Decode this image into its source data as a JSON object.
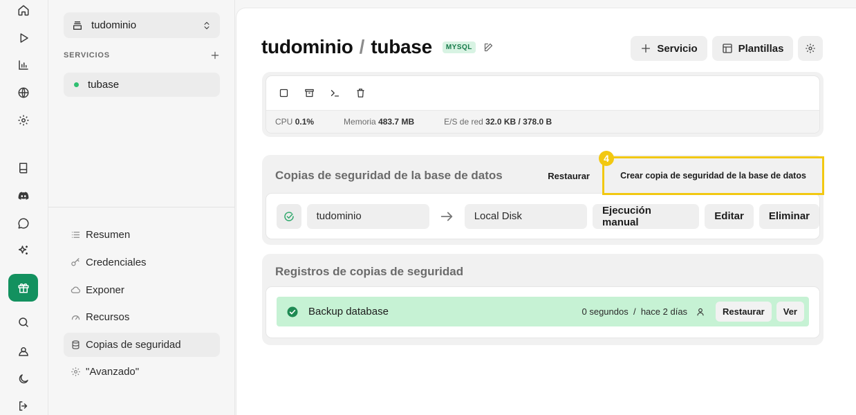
{
  "rail": {
    "items": [
      {
        "icon": "home-icon"
      },
      {
        "icon": "play-icon"
      },
      {
        "icon": "bar-chart-icon"
      },
      {
        "icon": "globe-icon"
      },
      {
        "icon": "gear-icon"
      },
      {
        "icon": "book-icon"
      },
      {
        "icon": "discord-icon"
      },
      {
        "icon": "chat-bubble-icon"
      },
      {
        "icon": "sparkles-icon"
      },
      {
        "icon": "gift-icon",
        "active": true
      },
      {
        "icon": "search-icon"
      },
      {
        "icon": "user-circle-icon"
      },
      {
        "icon": "moon-icon"
      },
      {
        "icon": "logout-icon"
      }
    ],
    "accent": "#13915f"
  },
  "sidebar": {
    "project_name": "tudominio",
    "services_label": "SERVICIOS",
    "services": [
      {
        "name": "tubase",
        "status_color": "#2fbf71"
      }
    ],
    "nav": [
      {
        "label": "Resumen",
        "icon": "list-icon"
      },
      {
        "label": "Credenciales",
        "icon": "key-icon"
      },
      {
        "label": "Exponer",
        "icon": "cloud-icon"
      },
      {
        "label": "Recursos",
        "icon": "gauge-icon"
      },
      {
        "label": "Copias de seguridad",
        "icon": "database-icon",
        "active": true
      },
      {
        "label": "\"Avanzado\"",
        "icon": "gear-icon"
      }
    ]
  },
  "header": {
    "project": "tudominio",
    "separator": "/",
    "service": "tubase",
    "db_badge": "MYSQL",
    "actions": {
      "add_service": "Servicio",
      "templates": "Plantillas"
    }
  },
  "status": {
    "stats": [
      {
        "label": "CPU",
        "value": "0.1%"
      },
      {
        "label": "Memoria",
        "value": "483.7 MB"
      },
      {
        "label": "E/S de red",
        "value": "32.0 KB / 378.0 B"
      }
    ]
  },
  "backups": {
    "title": "Copias de seguridad de la base de datos",
    "restore_label": "Restaurar",
    "create_label": "Crear copia de seguridad de la base de datos",
    "step_number": "4",
    "highlight_color": "#f2c811",
    "item": {
      "source": "tudominio",
      "destination": "Local Disk",
      "run_label": "Ejecución manual",
      "edit_label": "Editar",
      "delete_label": "Eliminar"
    }
  },
  "logs": {
    "title": "Registros de copias de seguridad",
    "entry": {
      "name": "Backup database",
      "duration": "0 segundos",
      "sep": "/",
      "when": "hace 2 días",
      "restore_label": "Restaurar",
      "view_label": "Ver",
      "status_color": "#c6f2d4"
    }
  }
}
